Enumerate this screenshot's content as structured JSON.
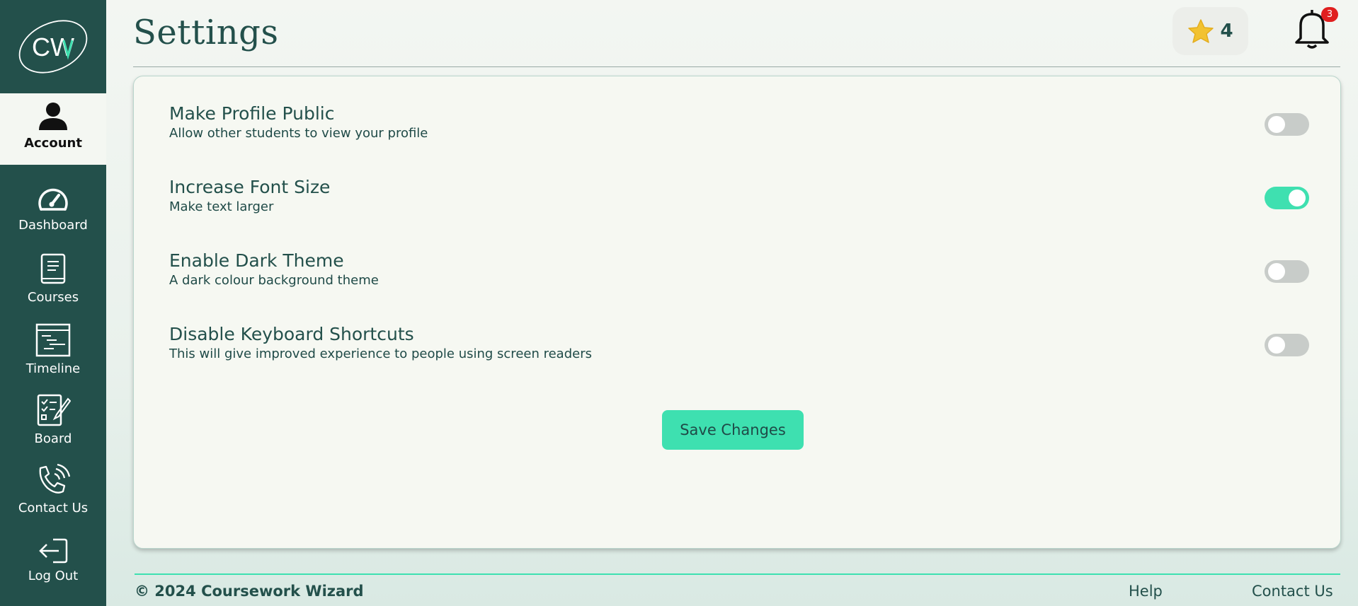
{
  "app": {
    "logo_text": "CW"
  },
  "sidebar": {
    "items": [
      {
        "label": "Account",
        "icon": "person-icon",
        "active": true
      },
      {
        "label": "Dashboard",
        "icon": "speedometer-icon"
      },
      {
        "label": "Courses",
        "icon": "book-icon"
      },
      {
        "label": "Timeline",
        "icon": "timeline-icon"
      },
      {
        "label": "Board",
        "icon": "checklist-icon"
      },
      {
        "label": "Contact Us",
        "icon": "phone-icon"
      },
      {
        "label": "Log Out",
        "icon": "logout-icon"
      }
    ]
  },
  "header": {
    "title": "Settings",
    "points": "4",
    "notification_count": "3"
  },
  "settings": [
    {
      "title": "Make Profile Public",
      "description": "Allow other students to view your profile",
      "enabled": false
    },
    {
      "title": "Increase Font Size",
      "description": "Make text larger",
      "enabled": true
    },
    {
      "title": "Enable Dark Theme",
      "description": "A dark colour background theme",
      "enabled": false
    },
    {
      "title": "Disable Keyboard Shortcuts",
      "description": "This will give improved experience to people using screen readers",
      "enabled": false
    }
  ],
  "actions": {
    "save_label": "Save Changes"
  },
  "footer": {
    "copyright": "© 2024 Coursework Wizard",
    "links": [
      "Help",
      "Contact Us"
    ]
  },
  "colors": {
    "sidebar": "#23504b",
    "accent": "#3ee0b0",
    "text": "#23504b",
    "badge_red": "#e01f1f",
    "star": "#f2c230"
  }
}
